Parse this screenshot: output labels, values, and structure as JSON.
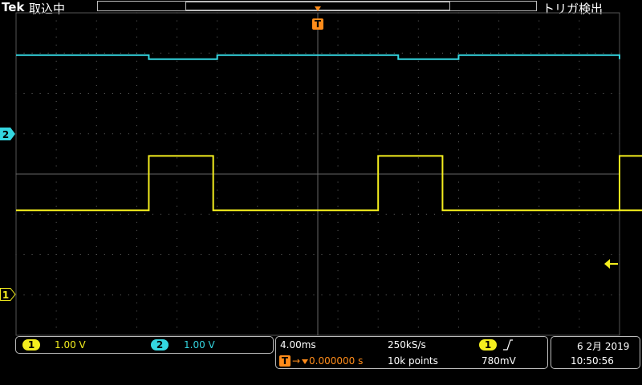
{
  "topbar": {
    "brand": "Tek",
    "acq_status": "取込中",
    "trigger_status": "トリガ検出"
  },
  "channels": {
    "ch1": {
      "label": "1",
      "scale": "1.00 V",
      "color": "#f4ee1e"
    },
    "ch2": {
      "label": "2",
      "scale": "1.00 V",
      "color": "#34d6e0"
    }
  },
  "timebase": {
    "scale": "4.00ms",
    "sample_rate": "250kS/s",
    "record_length": "10k points",
    "trigger_delay": "0.000000 s",
    "trigger_icon": "T",
    "trigger_source": "1",
    "trigger_slope_icon": "rising-edge-icon",
    "trigger_level": "780mV"
  },
  "datetime": {
    "date": "6 2月 2019",
    "time": "10:50:56"
  },
  "trigger_marker": {
    "label": "T",
    "color": "#ff8c1a"
  },
  "waveforms": {
    "ch1_pulses": [
      [
        3.3,
        4.9
      ],
      [
        9.0,
        10.6
      ],
      [
        15.0,
        16.7
      ]
    ],
    "ch1_low_div": -0.9,
    "ch1_high_div": 0.45,
    "ch2_segments": [
      [
        0,
        3.3,
        2.95
      ],
      [
        3.3,
        5.0,
        2.85
      ],
      [
        5.0,
        9.5,
        2.95
      ],
      [
        9.5,
        11.0,
        2.85
      ],
      [
        11.0,
        15.3,
        2.95
      ],
      [
        15.3,
        16.7,
        2.85
      ],
      [
        16.7,
        18.5,
        2.95
      ]
    ]
  }
}
